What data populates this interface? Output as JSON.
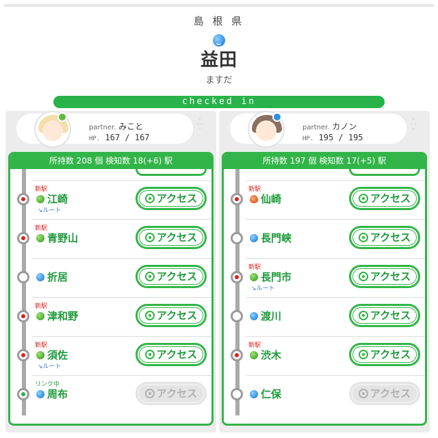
{
  "header": {
    "prefecture": "島 根 県",
    "station_name": "益田",
    "station_kana": "ますだ",
    "attribute_icon": "water-drop-icon",
    "checked_in": "checked in"
  },
  "colors": {
    "accent_green": "#32b548",
    "new_red": "#d9241b",
    "link_green": "#2aa147",
    "route_blue": "#3a7bd5"
  },
  "left": {
    "partner_label": "partner.",
    "partner_name": "みこと",
    "hp_label": "HP.",
    "hp": "167 / 167",
    "summary": "所持数 208 個 検知数 18(+6) 駅",
    "stations": [
      {
        "tag": "新駅",
        "name": "江崎",
        "icon": "leaf-icon",
        "route": "ルート",
        "button": "アクセス",
        "enabled": true
      },
      {
        "tag": "新駅",
        "name": "青野山",
        "icon": "leaf-icon",
        "route": "",
        "button": "アクセス",
        "enabled": true
      },
      {
        "tag": "",
        "name": "折居",
        "icon": "water-drop-icon",
        "route": "",
        "button": "アクセス",
        "enabled": true
      },
      {
        "tag": "新駅",
        "name": "津和野",
        "icon": "leaf-icon",
        "route": "",
        "button": "アクセス",
        "enabled": true
      },
      {
        "tag": "新駅",
        "name": "須佐",
        "icon": "leaf-icon",
        "route": "ルート",
        "button": "アクセス",
        "enabled": true
      },
      {
        "tag": "リンク中",
        "name": "周布",
        "icon": "water-drop-icon",
        "route": "",
        "button": "アクセス",
        "enabled": false
      }
    ]
  },
  "right": {
    "partner_label": "partner.",
    "partner_name": "カノン",
    "hp_label": "HP.",
    "hp": "195 / 195",
    "summary": "所持数 197 個 検知数 17(+5) 駅",
    "stations": [
      {
        "tag": "新駅",
        "name": "仙崎",
        "icon": "fire-icon",
        "route": "",
        "button": "アクセス",
        "enabled": true
      },
      {
        "tag": "",
        "name": "長門峡",
        "icon": "water-drop-icon",
        "route": "",
        "button": "アクセス",
        "enabled": true
      },
      {
        "tag": "新駅",
        "name": "長門市",
        "icon": "leaf-icon",
        "route": "ルート",
        "button": "アクセス",
        "enabled": true
      },
      {
        "tag": "",
        "name": "渡川",
        "icon": "water-drop-icon",
        "route": "",
        "button": "アクセス",
        "enabled": true
      },
      {
        "tag": "新駅",
        "name": "渋木",
        "icon": "leaf-icon",
        "route": "",
        "button": "アクセス",
        "enabled": true
      },
      {
        "tag": "",
        "name": "仁保",
        "icon": "water-drop-icon",
        "route": "",
        "button": "アクセス",
        "enabled": false
      }
    ]
  }
}
